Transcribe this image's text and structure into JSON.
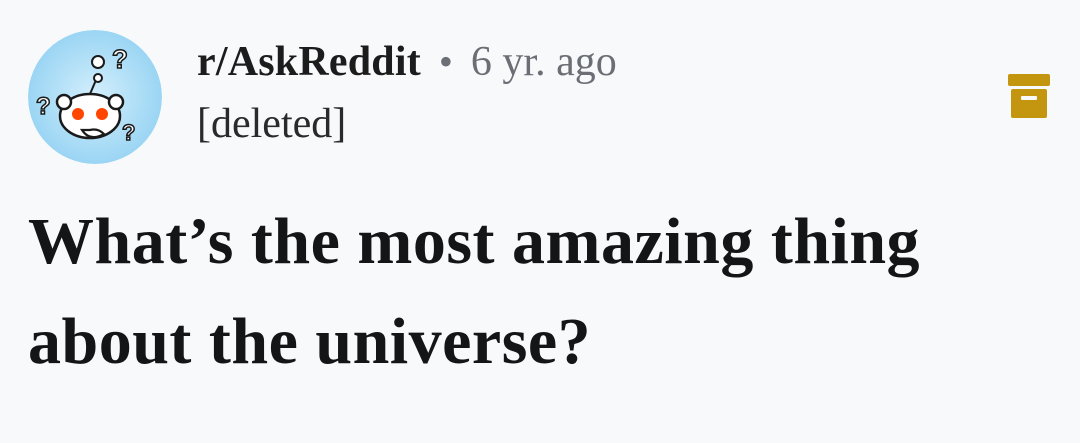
{
  "post": {
    "subreddit": "r/AskReddit",
    "separator": "•",
    "timestamp": "6 yr. ago",
    "author": "[deleted]",
    "title": "What’s the most amazing thing about the universe?"
  },
  "icons": {
    "avatar": "askreddit-snoo-icon",
    "archive": "archive-box-icon"
  },
  "colors": {
    "archive_icon": "#c4950e",
    "avatar_bg": "#9fd8f5",
    "snoo_eyes": "#ff4500"
  }
}
